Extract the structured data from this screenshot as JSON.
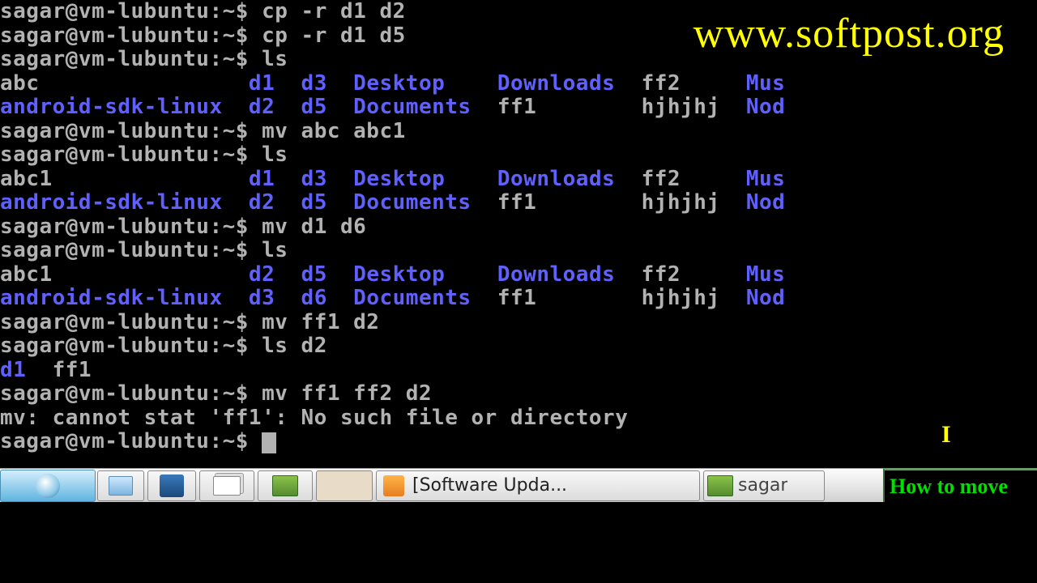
{
  "watermark": "www.softpost.org",
  "prompt": "sagar@vm-lubuntu:~$ ",
  "lines": {
    "l0": "cp -r d1 d2",
    "l1": "cp -r d1 d5",
    "l2": "ls",
    "l3": "mv abc abc1",
    "l4": "ls",
    "l5": "mv d1 d6",
    "l6": "ls",
    "l7": "mv ff1 d2",
    "l8": "ls d2",
    "l9": "mv ff1 ff2 d2",
    "l10_err": "mv: cannot stat 'ff1': No such file or directory"
  },
  "ls1": {
    "r0c0": "abc",
    "r0c1": "d1",
    "r0c2": "d3",
    "r0c3": "Desktop",
    "r0c4": "Downloads",
    "r0c5": "ff2",
    "r0c6": "Mus",
    "r1c0": "android-sdk-linux",
    "r1c1": "d2",
    "r1c2": "d5",
    "r1c3": "Documents",
    "r1c4": "ff1",
    "r1c5": "hjhjhj",
    "r1c6": "Nod"
  },
  "ls2": {
    "r0c0": "abc1",
    "r0c1": "d1",
    "r0c2": "d3",
    "r0c3": "Desktop",
    "r0c4": "Downloads",
    "r0c5": "ff2",
    "r0c6": "Mus",
    "r1c0": "android-sdk-linux",
    "r1c1": "d2",
    "r1c2": "d5",
    "r1c3": "Documents",
    "r1c4": "ff1",
    "r1c5": "hjhjhj",
    "r1c6": "Nod"
  },
  "ls3": {
    "r0c0": "abc1",
    "r0c1": "d2",
    "r0c2": "d5",
    "r0c3": "Desktop",
    "r0c4": "Downloads",
    "r0c5": "ff2",
    "r0c6": "Mus",
    "r1c0": "android-sdk-linux",
    "r1c1": "d3",
    "r1c2": "d6",
    "r1c3": "Documents",
    "r1c4": "ff1",
    "r1c5": "hjhjhj",
    "r1c6": "Nod"
  },
  "ls4": {
    "c0": "d1",
    "c1": "ff1"
  },
  "taskbar": {
    "updater": "[Software Upda...",
    "term2": "sagar",
    "howto": "How to move"
  }
}
